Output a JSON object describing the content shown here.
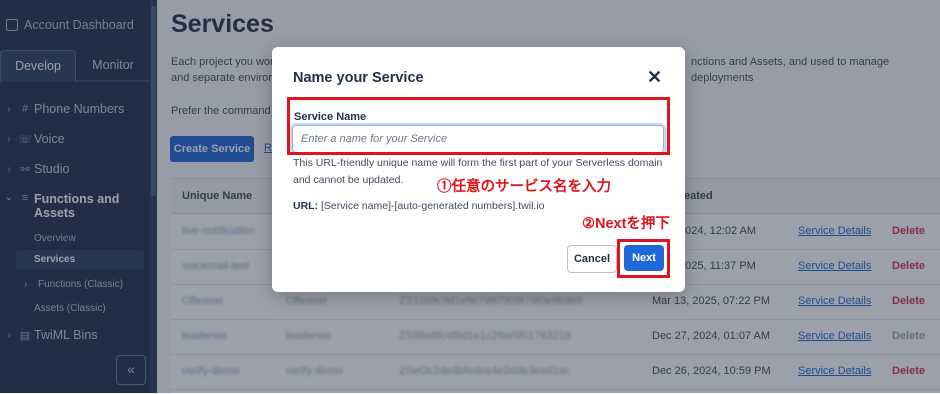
{
  "sidebar": {
    "title": "Account Dashboard",
    "tabs": [
      {
        "label": "Develop",
        "active": true
      },
      {
        "label": "Monitor",
        "active": false
      }
    ],
    "items": [
      {
        "label": "Phone Numbers",
        "icon": "hash-icon"
      },
      {
        "label": "Voice",
        "icon": "phone-icon"
      },
      {
        "label": "Studio",
        "icon": "flow-icon"
      },
      {
        "label": "Functions and Assets",
        "icon": "functions-icon"
      },
      {
        "label": "TwiML Bins",
        "icon": "bin-icon"
      }
    ],
    "subitems": [
      {
        "label": "Overview"
      },
      {
        "label": "Services",
        "active": true
      },
      {
        "label": "Functions (Classic)"
      },
      {
        "label": "Assets (Classic)"
      }
    ],
    "collapse_glyph": "«"
  },
  "main": {
    "title": "Services",
    "description_left": "Each project you work",
    "description_right": "nctions and Assets, and used to manage deployments",
    "description_line2": "and separate environ",
    "prefer_text": "Prefer the command li",
    "create_button": "Create Service",
    "side_link": "R",
    "table": {
      "headers": [
        "Unique Name",
        "eated"
      ],
      "rows": [
        {
          "name": "live-notification",
          "friendly": "",
          "sid": "",
          "date": "2024, 12:02 AM",
          "details": "Service Details",
          "delete": "Delete"
        },
        {
          "name": "voicemail-test",
          "friendly": "",
          "sid": "",
          "date": "2025, 11:37 PM",
          "details": "Service Details",
          "delete": "Delete"
        },
        {
          "name": "Ofleaser",
          "friendly": "Ofleaser",
          "sid": "ZS11b9c9d1e9c7997909f79f0e9b9b9",
          "date": "Mar 13, 2025, 07:22 PM",
          "details": "Service Details",
          "delete": "Delete"
        },
        {
          "name": "leaderwo",
          "friendly": "leaderwo",
          "sid": "ZS98e8fc4f8d1e1c2f6e5f01763216",
          "date": "Dec 27, 2024, 01:07 AM",
          "details": "Service Details",
          "delete": "Delete"
        },
        {
          "name": "verify-demo",
          "friendly": "verify demo",
          "sid": "ZSeOc2dedbfedee4e2dde3eed1ac",
          "date": "Dec 26, 2024, 10:59 PM",
          "details": "Service Details",
          "delete": "Delete"
        }
      ]
    }
  },
  "modal": {
    "title": "Name your Service",
    "close_glyph": "✕",
    "field_label": "Service Name",
    "input_value": "",
    "input_placeholder": "Enter a name for your Service",
    "help_text": "This URL-friendly unique name will form the first part of your Serverless domain and cannot be updated.",
    "url_label": "URL:",
    "url_value": "[Service name]-[auto-generated numbers].twil.io",
    "cancel_label": "Cancel",
    "next_label": "Next"
  },
  "annotations": {
    "step1": "①任意のサービス名を入力",
    "step2": "②Nextを押下",
    "color": "#e0141c"
  }
}
